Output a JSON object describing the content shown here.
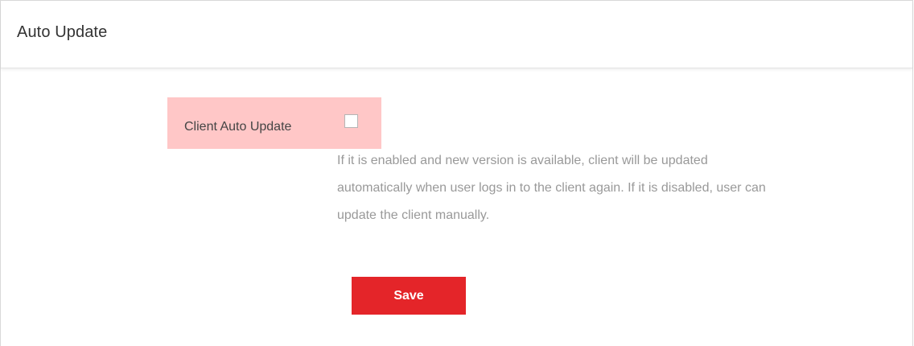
{
  "page": {
    "title": "Auto Update"
  },
  "form": {
    "client_auto_update": {
      "label": "Client Auto Update",
      "checked": false,
      "hint_lines": [
        "If it is enabled and new version is available, client will be updated",
        "automatically when user logs in to the client again. If it is disabled, user can",
        "update the client manually."
      ]
    },
    "save_label": "Save"
  },
  "colors": {
    "highlight": "#ffc7c7",
    "save_button": "#e42529",
    "hint_text": "#999999"
  }
}
